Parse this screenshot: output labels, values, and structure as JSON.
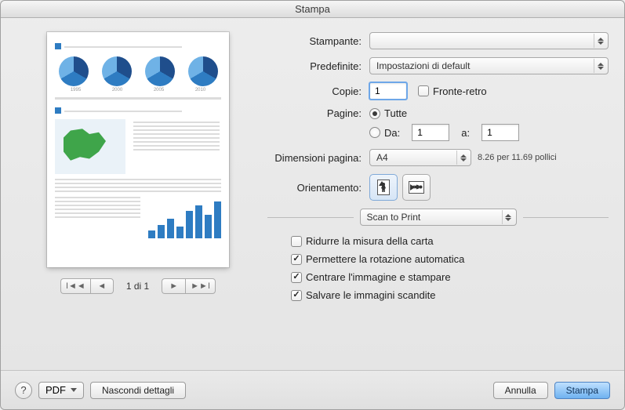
{
  "window": {
    "title": "Stampa"
  },
  "labels": {
    "printer": "Stampante:",
    "presets": "Predefinite:",
    "copies": "Copie:",
    "duplex": "Fronte-retro",
    "pages": "Pagine:",
    "pages_all": "Tutte",
    "pages_from": "Da:",
    "pages_to": "a:",
    "page_size": "Dimensioni pagina:",
    "orientation": "Orientamento:"
  },
  "values": {
    "printer_selected": " ",
    "preset_selected": "Impostazioni di default",
    "copies": "1",
    "duplex_checked": false,
    "pages_mode": "all",
    "pages_from": "1",
    "pages_to": "1",
    "page_size_selected": "A4",
    "page_size_note": "8.26 per 11.69 pollici",
    "orientation": "portrait",
    "section_selected": "Scan to Print"
  },
  "options": {
    "reduce_paper": {
      "label": "Ridurre la misura della carta",
      "checked": false
    },
    "auto_rotate": {
      "label": "Permettere la rotazione automatica",
      "checked": true
    },
    "center_image": {
      "label": "Centrare l'immagine e stampare",
      "checked": true
    },
    "save_scanned": {
      "label": "Salvare le immagini scandite",
      "checked": true
    }
  },
  "preview": {
    "page_indicator": "1 di 1",
    "years": [
      "1995",
      "2000",
      "2005",
      "2010"
    ]
  },
  "footer": {
    "pdf_label": "PDF",
    "hide_details": "Nascondi dettagli",
    "cancel": "Annulla",
    "print": "Stampa"
  }
}
